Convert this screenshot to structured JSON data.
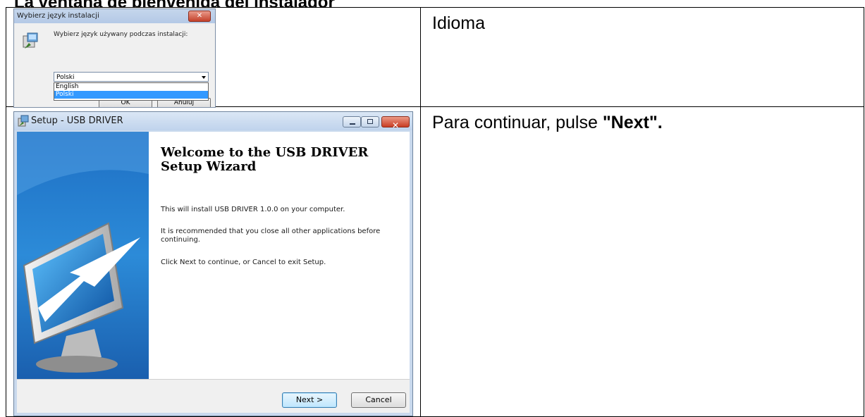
{
  "document": {
    "heading": "La ventana de bienvenida del instalador",
    "row1_caption": "Idioma",
    "row2_caption_prefix": "Para continuar, pulse ",
    "row2_caption_bold": "\"Next\"."
  },
  "language_dialog": {
    "title": "Wybierz język instalacji",
    "prompt": "Wybierz język używany podczas instalacji:",
    "selected_value": "Polski",
    "options": [
      "English",
      "Polski"
    ],
    "ok_label": "OK",
    "cancel_label": "Anuluj"
  },
  "setup_wizard": {
    "title": "Setup - USB DRIVER",
    "heading_line1": "Welcome to the USB DRIVER",
    "heading_line2": "Setup Wizard",
    "para1": "This will install USB DRIVER 1.0.0 on your computer.",
    "para2": "It is recommended that you close all other applications before continuing.",
    "para3": "Click Next to continue, or Cancel to exit Setup.",
    "next_label": "Next >",
    "cancel_label": "Cancel"
  }
}
